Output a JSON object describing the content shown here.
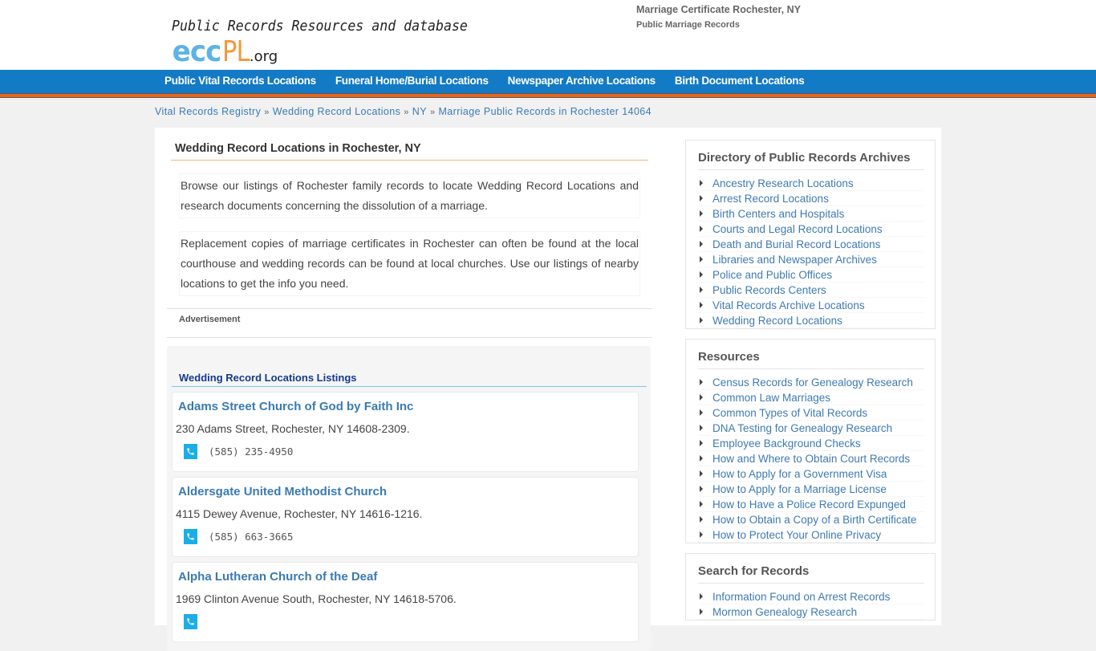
{
  "header": {
    "tagline": "Public Records Resources and database",
    "logo": {
      "ecc": "ecc",
      "pl": "PL",
      "org": ".org"
    },
    "right_title": "Marriage Certificate Rochester, NY",
    "right_subtitle": "Public Marriage Records"
  },
  "nav": {
    "items": [
      {
        "label": "Public Vital Records Locations"
      },
      {
        "label": "Funeral Home/Burial Locations"
      },
      {
        "label": "Newspaper Archive Locations"
      },
      {
        "label": "Birth Document Locations"
      }
    ]
  },
  "breadcrumb": {
    "items": [
      {
        "label": "Vital Records Registry"
      },
      {
        "label": "Wedding Record Locations"
      },
      {
        "label": "NY"
      },
      {
        "label": "Marriage Public Records in Rochester 14064"
      }
    ],
    "separator": "»"
  },
  "main": {
    "title": "Wedding Record Locations in Rochester, NY",
    "paragraphs": [
      "Browse our listings of Rochester family records to locate Wedding Record Locations and research documents concerning the dissolution of a marriage.",
      "Replacement copies of marriage certificates in Rochester can often be found at the local courthouse and wedding records can be found at local churches. Use our listings of nearby locations to get the info you need."
    ],
    "ad_label": "Advertisement",
    "listings_title": "Wedding Record Locations Listings",
    "listings": [
      {
        "name": "Adams Street Church of God by Faith Inc",
        "address": "230 Adams Street, Rochester, NY 14608-2309.",
        "phone": "(585) 235-4950"
      },
      {
        "name": "Aldersgate United Methodist Church",
        "address": "4115 Dewey Avenue, Rochester, NY 14616-1216.",
        "phone": "(585) 663-3665"
      },
      {
        "name": "Alpha Lutheran Church of the Deaf",
        "address": "1969 Clinton Avenue South, Rochester, NY 14618-5706.",
        "phone": ""
      }
    ]
  },
  "sidebar": {
    "directory": {
      "title": "Directory of Public Records Archives",
      "items": [
        "Ancestry Research Locations",
        "Arrest Record Locations",
        "Birth Centers and Hospitals",
        "Courts and Legal Record Locations",
        "Death and Burial Record Locations",
        "Libraries and Newspaper Archives",
        "Police and Public Offices",
        "Public Records Centers",
        "Vital Records Archive Locations",
        "Wedding Record Locations"
      ]
    },
    "resources": {
      "title": "Resources",
      "items": [
        "Census Records for Genealogy Research",
        "Common Law Marriages",
        "Common Types of Vital Records",
        "DNA Testing for Genealogy Research",
        "Employee Background Checks",
        "How and Where to Obtain Court Records",
        "How to Apply for a Government Visa",
        "How to Apply for a Marriage License",
        "How to Have a Police Record Expunged",
        "How to Obtain a Copy of a Birth Certificate",
        "How to Protect Your Online Privacy"
      ]
    },
    "search": {
      "title": "Search for Records",
      "items": [
        "Information Found on Arrest Records",
        "Mormon Genealogy Research"
      ]
    }
  },
  "colors": {
    "nav_blue": "#137ac6",
    "nav_orange": "#e8641b",
    "link_blue": "#3f7ab2",
    "phone_icon": "#19aeea",
    "logo_blue": "#5db3e6",
    "logo_orange": "#f29a3a"
  }
}
